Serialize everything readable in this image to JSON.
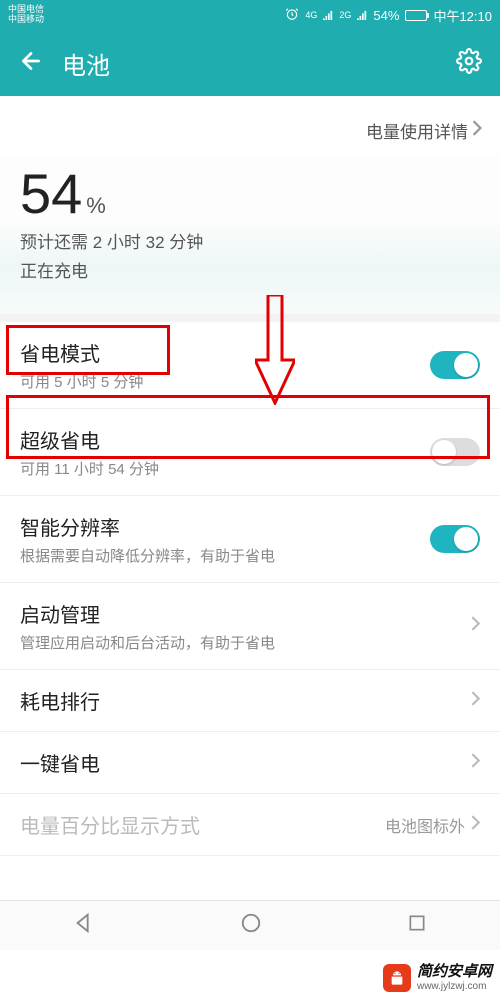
{
  "status_bar": {
    "carrier1": "中国电信",
    "carrier2": "中国移动",
    "signal1": "4G",
    "signal2": "2G",
    "battery_pct": "54%",
    "time": "中午12:10"
  },
  "header": {
    "title": "电池"
  },
  "usage_link": "电量使用详情",
  "battery": {
    "percent": "54",
    "unit": "%",
    "estimate": "预计还需 2 小时 32 分钟",
    "status": "正在充电"
  },
  "colors": {
    "accent": "#1fadb0",
    "highlight": "#e30000"
  },
  "items": [
    {
      "title": "省电模式",
      "sub": "可用 5 小时 5 分钟",
      "toggle": "on"
    },
    {
      "title": "超级省电",
      "sub": "可用 11 小时 54 分钟",
      "toggle": "off"
    },
    {
      "title": "智能分辨率",
      "sub": "根据需要自动降低分辨率，有助于省电",
      "toggle": "on"
    },
    {
      "title": "启动管理",
      "sub": "管理应用启动和后台活动，有助于省电",
      "arrow": true
    },
    {
      "title": "耗电排行",
      "arrow": true
    },
    {
      "title": "一键省电",
      "arrow": true
    },
    {
      "title": "电量百分比显示方式",
      "value": "电池图标外",
      "arrow": true,
      "dim": true
    }
  ],
  "watermark": {
    "title": "简约安卓网",
    "url": "www.jylzwj.com"
  }
}
